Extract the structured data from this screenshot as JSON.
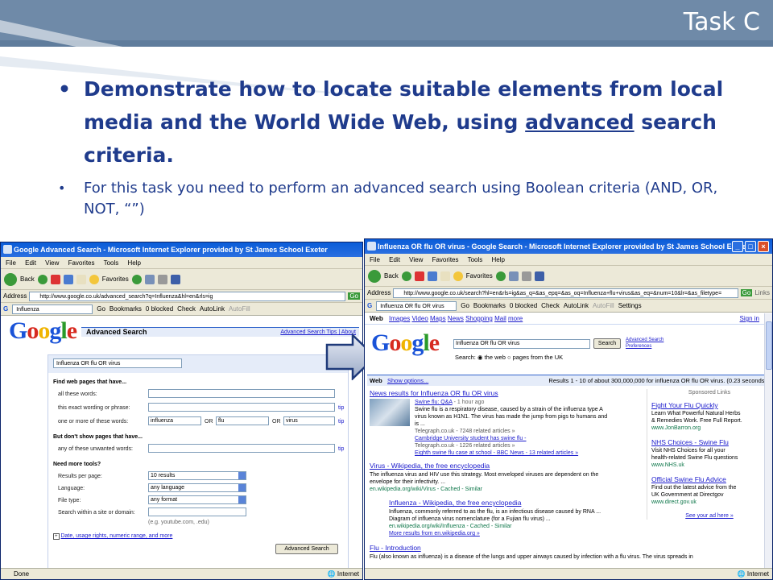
{
  "slide": {
    "title": "Task C",
    "bullet1_pre": "Demonstrate how to locate suitable elements from local media and the World Wide Web, using",
    "bullet1_under": "advanced",
    "bullet1_post": "search criteria.",
    "bullet2": "For this task you need to perform an advanced search using Boolean criteria (AND, OR, NOT, “”)"
  },
  "left_window": {
    "title": "Google Advanced Search - Microsoft Internet Explorer provided by St James School Exeter",
    "menu": [
      "File",
      "Edit",
      "View",
      "Favorites",
      "Tools",
      "Help"
    ],
    "back_label": "Back",
    "favorites_label": "Favorites",
    "address_label": "Address",
    "address": "http://www.google.co.uk/advanced_search?q=Influenza&hl=en&rls=ig",
    "go_label": "Go",
    "gbar_query": "Influenza",
    "gbar_items": [
      "Go",
      "Bookmarks",
      "0 blocked",
      "Check",
      "AutoLink",
      "AutoFill"
    ],
    "adv_title": "Advanced Search",
    "adv_links": "Advanced Search Tips | About",
    "query": "Influenza OR flu OR virus",
    "find_heading": "Find web pages that have...",
    "all_words": "all these words:",
    "exact": "this exact wording or phrase:",
    "one_or_more": "one or more of these words:",
    "or_word": "OR",
    "or_values": [
      "influenza",
      "flu",
      "virus"
    ],
    "tip": "tip",
    "dont_show": "But don't show pages that have...",
    "unwanted": "any of these unwanted words:",
    "need_more": "Need more tools?",
    "results_per_page": "Results per page:",
    "results_value": "10 results",
    "language": "Language:",
    "language_value": "any language",
    "file_type": "File type:",
    "file_type_value": "any format",
    "search_within": "Search within a site or domain:",
    "domain_example": "(e.g. youtube.com, .edu)",
    "date_link": "Date, usage rights, numeric range, and more",
    "submit": "Advanced Search",
    "status_left": "Done",
    "status_zone": "Internet"
  },
  "right_window": {
    "title": "Influenza OR flu OR virus - Google Search - Microsoft Internet Explorer provided by St James School Exeter",
    "menu": [
      "File",
      "Edit",
      "View",
      "Favorites",
      "Tools",
      "Help"
    ],
    "back_label": "Back",
    "favorites_label": "Favorites",
    "address_label": "Address",
    "address": "http://www.google.co.uk/search?hl=en&rls=ig&as_q=&as_epq=&as_oq=Influenza+flu+virus&as_eq=&num=10&lr=&as_filetype=",
    "go_label": "Go",
    "links_label": "Links",
    "gbar_query": "Influenza OR flu OR virus",
    "gbar_items": [
      "Go",
      "Bookmarks",
      "0 blocked",
      "Check",
      "AutoLink",
      "AutoFill",
      "Settings"
    ],
    "tabs": [
      "Web",
      "Images",
      "Video",
      "Maps",
      "News",
      "Shopping",
      "Mail",
      "more"
    ],
    "sign_in": "Sign in",
    "search_value": "Influenza OR flu OR virus",
    "search_btn": "Search",
    "adv_link": "Advanced Search",
    "prefs_link": "Preferences",
    "search_label": "Search:",
    "radio1": "the web",
    "radio2": "pages from the UK",
    "hdr_web": "Web",
    "hdr_show": "Show options...",
    "hdr_results": "Results 1 - 10 of about 300,000,000 for influenza OR flu OR virus. (0.23 seconds)",
    "news_title": "News results for Influenza OR flu OR virus",
    "news1_title": "Swine flu: Q&A",
    "news1_time": "- 1 hour ago",
    "news1_l1": "Swine flu is a respiratory disease, caused by a strain of the influenza type A",
    "news1_l2": "virus known as H1N1. The virus has made the jump from pigs to humans and",
    "news1_l3": "is ...",
    "news1_src": "Telegraph.co.uk - 7248 related articles »",
    "news2": "Cambridge University student has swine flu -",
    "news2_src": "Telegraph.co.uk - 1226 related articles »",
    "news3": "Eighth swine flu case at school - BBC News - 13 related articles »",
    "r1_title": "Virus - Wikipedia, the free encyclopedia",
    "r1_l1": "The influenza virus and HIV use this strategy. Most enveloped viruses are dependent on the",
    "r1_l2": "envelope for their infectivity. ...",
    "r1_url": "en.wikipedia.org/wiki/Virus - Cached - Similar",
    "r2_title": "Influenza - Wikipedia, the free encyclopedia",
    "r2_l1": "Influenza, commonly referred to as the flu, is an infectious disease caused by RNA ...",
    "r2_l2": "Diagram of influenza virus nomenclature (for a Fujian flu virus) ...",
    "r2_url": "en.wikipedia.org/wiki/Influenza - Cached - Similar",
    "r2_more": "More results from en.wikipedia.org »",
    "r3_title": "Flu - Introduction",
    "r3_l1": "Flu (also known as influenza) is a disease of the lungs and upper airways caused by infection with a flu virus. The virus spreads in",
    "ads_head": "Sponsored Links",
    "ads": [
      {
        "title": "Fight Your Flu Quickly",
        "l1": "Learn What Powerful Natural Herbs",
        "l2": "& Remedies Work. Free Full Report.",
        "url": "www.JonBarron.org"
      },
      {
        "title": "NHS Choices - Swine Flu",
        "l1": "Visit NHS Choices for all your",
        "l2": "health-related Swine Flu questions",
        "url": "www.NHS.uk"
      },
      {
        "title": "Official Swine Flu Advice",
        "l1": "Find out the latest advice from the",
        "l2": "UK Government at Directgov",
        "url": "www.direct.gov.uk"
      }
    ],
    "see_ad": "See your ad here »",
    "status_zone": "Internet"
  }
}
